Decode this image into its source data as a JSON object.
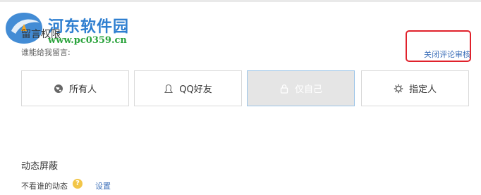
{
  "watermark": {
    "title": "河东软件园",
    "url": "www.pc0359.cn"
  },
  "permission": {
    "title": "留言权限",
    "who_can_message": "谁能给我留言:",
    "close_review_link": "关闭评论审核",
    "options": [
      {
        "label": "所有人",
        "icon": "globe-icon",
        "selected": false
      },
      {
        "label": "QQ好友",
        "icon": "friends-icon",
        "selected": false
      },
      {
        "label": "仅自己",
        "icon": "lock-icon",
        "selected": true
      },
      {
        "label": "指定人",
        "icon": "gear-icon",
        "selected": false
      }
    ]
  },
  "feed_block": {
    "title": "动态屏蔽",
    "not_see_label": "不看谁的动态",
    "help_icon_glyph": "?",
    "setting_link": "设置"
  },
  "colors": {
    "link": "#3c6fb9",
    "highlight_border": "#e0212b",
    "selected_bg": "#e5e5e5",
    "selected_border": "#9bc4e8",
    "help_icon": "#f2c649"
  }
}
